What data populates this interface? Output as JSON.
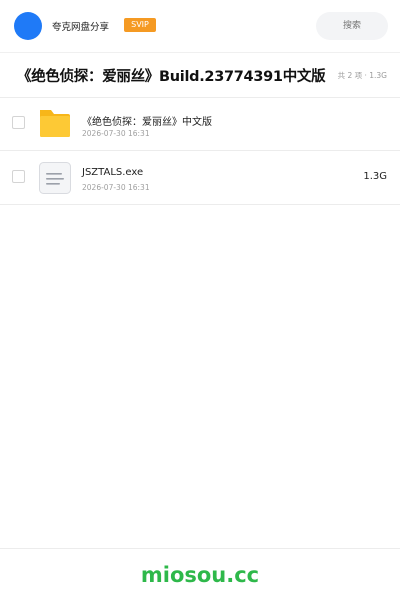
{
  "header": {
    "share_title": "夸克网盘分享",
    "badge": "SVIP",
    "search_placeholder": "搜索",
    "avatar_color": "#1f7af7",
    "badge_color": "#f59a23"
  },
  "folder": {
    "title": "《绝色侦探：爱丽丝》Build.23774391中文版",
    "summary": "共 2 项 · 1.3G"
  },
  "files": [
    {
      "name": "《绝色侦探：爱丽丝》中文版",
      "date": "2026-07-30 16:31",
      "size": "",
      "icon": "folder-icon",
      "icon_color": "#fdc935"
    },
    {
      "name": "JSZTALS.exe",
      "date": "2026-07-30 16:31",
      "size": "1.3G",
      "icon": "document-icon"
    }
  ],
  "footer": {
    "brand": "miosou.cc",
    "brand_color": "#2eb84a"
  }
}
